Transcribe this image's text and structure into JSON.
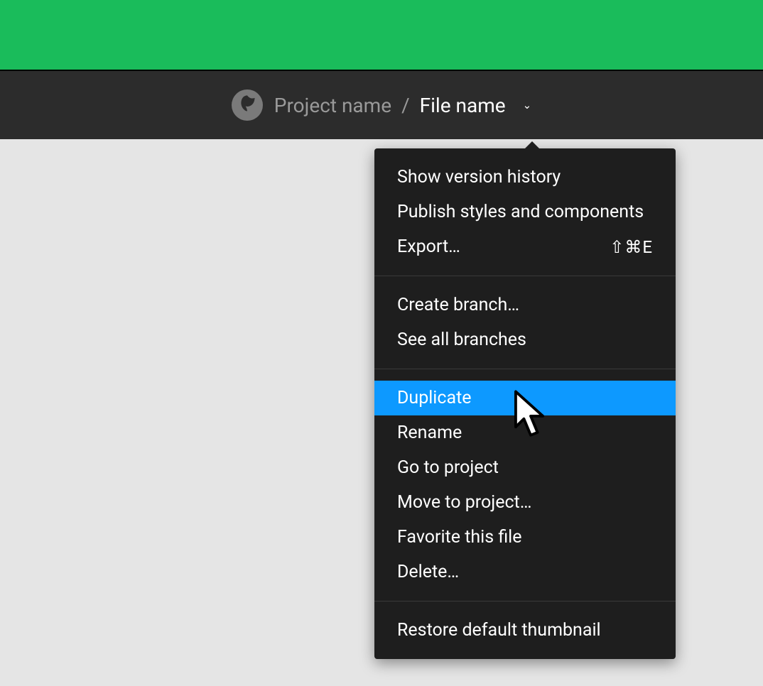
{
  "header": {
    "project_name": "Project name",
    "file_name": "File name",
    "separator": "/"
  },
  "menu": {
    "groups": [
      {
        "items": [
          {
            "label": "Show version history",
            "shortcut": "",
            "highlighted": false
          },
          {
            "label": "Publish styles and components",
            "shortcut": "",
            "highlighted": false
          },
          {
            "label": "Export…",
            "shortcut": "⇧⌘E",
            "highlighted": false
          }
        ]
      },
      {
        "items": [
          {
            "label": "Create branch…",
            "shortcut": "",
            "highlighted": false
          },
          {
            "label": "See all branches",
            "shortcut": "",
            "highlighted": false
          }
        ]
      },
      {
        "items": [
          {
            "label": "Duplicate",
            "shortcut": "",
            "highlighted": true
          },
          {
            "label": "Rename",
            "shortcut": "",
            "highlighted": false
          },
          {
            "label": "Go to project",
            "shortcut": "",
            "highlighted": false
          },
          {
            "label": "Move to project…",
            "shortcut": "",
            "highlighted": false
          },
          {
            "label": "Favorite this file",
            "shortcut": "",
            "highlighted": false
          },
          {
            "label": "Delete…",
            "shortcut": "",
            "highlighted": false
          }
        ]
      },
      {
        "items": [
          {
            "label": "Restore default thumbnail",
            "shortcut": "",
            "highlighted": false
          }
        ]
      }
    ]
  }
}
